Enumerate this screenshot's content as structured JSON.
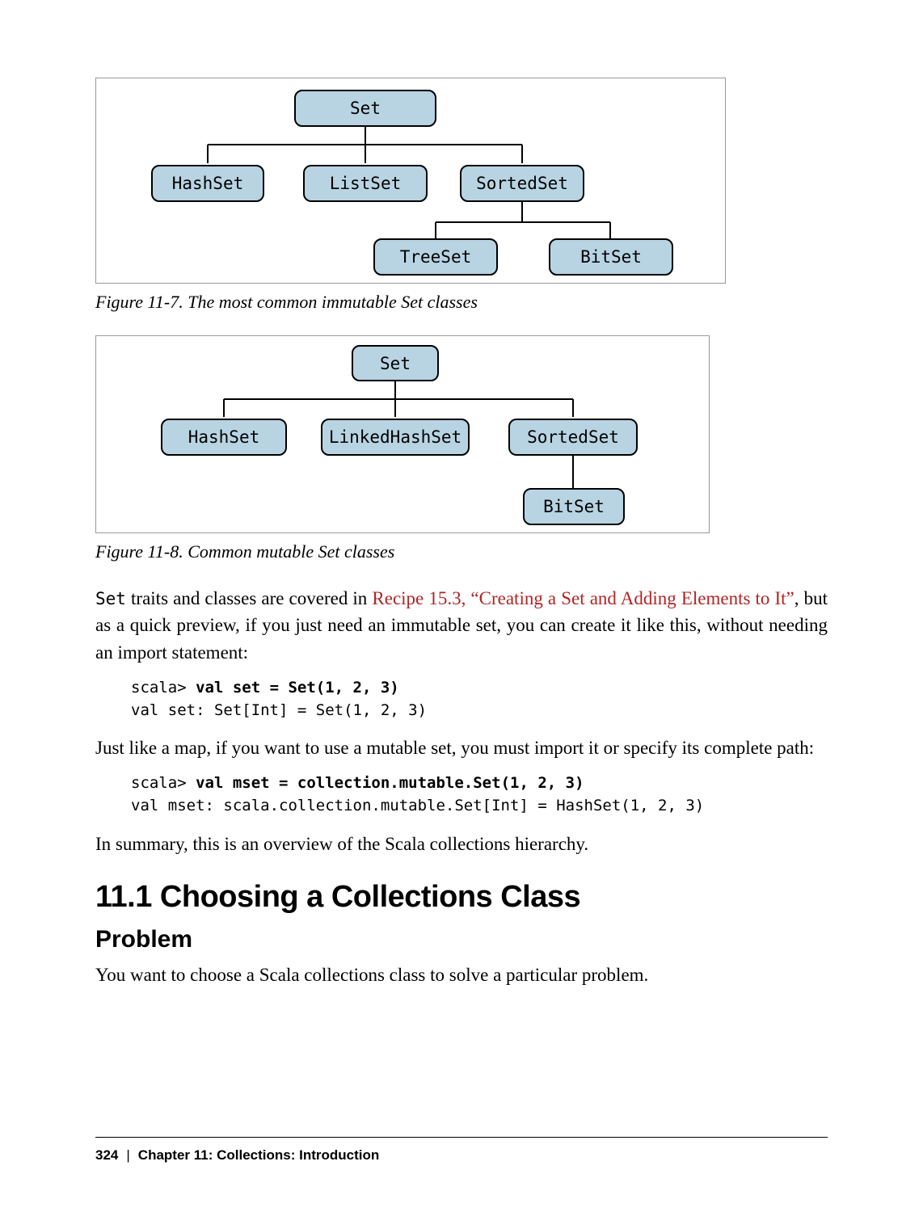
{
  "figure7": {
    "caption": "Figure 11-7. The most common immutable Set classes",
    "nodes": {
      "root": "Set",
      "l1a": "HashSet",
      "l1b": "ListSet",
      "l1c": "SortedSet",
      "l2a": "TreeSet",
      "l2b": "BitSet"
    }
  },
  "figure8": {
    "caption": "Figure 11-8. Common mutable Set classes",
    "nodes": {
      "root": "Set",
      "l1a": "HashSet",
      "l1b": "LinkedHashSet",
      "l1c": "SortedSet",
      "l2a": "BitSet"
    }
  },
  "para1_pre": "Set",
  "para1_mid": " traits and classes are covered in ",
  "para1_link": "Recipe 15.3, “Creating a Set and Adding Elements to It”",
  "para1_post": ", but as a quick preview, if you just need an immutable set, you can create it like this, without needing an import statement:",
  "code1_prompt": "scala> ",
  "code1_bold": "val set = Set(1, 2, 3)",
  "code1_out": "val set: Set[Int] = Set(1, 2, 3)",
  "para2": "Just like a map, if you want to use a mutable set, you must import it or specify its complete path:",
  "code2_prompt": "scala> ",
  "code2_bold": "val mset = collection.mutable.Set(1, 2, 3)",
  "code2_out": "val mset: scala.collection.mutable.Set[Int] = HashSet(1, 2, 3)",
  "para3": "In summary, this is an overview of the Scala collections hierarchy.",
  "section_h1": "11.1 Choosing a Collections Class",
  "section_h2": "Problem",
  "para4": "You want to choose a Scala collections class to solve a particular problem.",
  "footer_page": "324",
  "footer_chapter": "Chapter 11: Collections: Introduction"
}
